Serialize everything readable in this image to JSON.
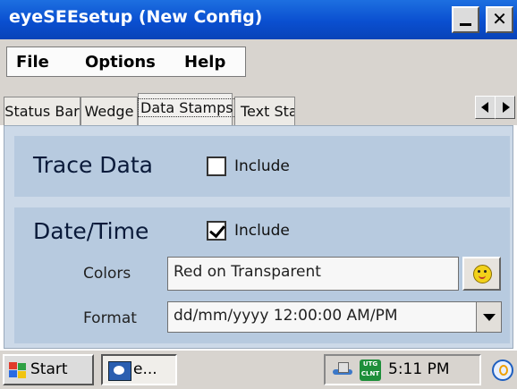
{
  "window": {
    "title": "eyeSEEsetup (New Config)"
  },
  "menu": {
    "items": [
      "File",
      "Options",
      "Help"
    ]
  },
  "tabs": [
    {
      "label": "Status Bar",
      "active": false
    },
    {
      "label": "Wedge",
      "active": false
    },
    {
      "label": "Data Stamps",
      "active": true
    },
    {
      "label": "Text Stamp",
      "active": false
    }
  ],
  "trace_data": {
    "title": "Trace Data",
    "include_label": "Include",
    "include_checked": false
  },
  "date_time": {
    "title": "Date/Time",
    "include_label": "Include",
    "include_checked": true,
    "colors_label": "Colors",
    "colors_value": "Red on Transparent",
    "format_label": "Format",
    "format_value": "dd/mm/yyyy 12:00:00 AM/PM"
  },
  "taskbar": {
    "start_label": "Start",
    "task_label": "e...",
    "tray_icon_text": "UTG CLNT",
    "clock": "5:11 PM"
  },
  "colors": {
    "titlebar": "#0a4fd0",
    "panel_bg": "#b7cadf",
    "chrome": "#d8d4cf"
  }
}
